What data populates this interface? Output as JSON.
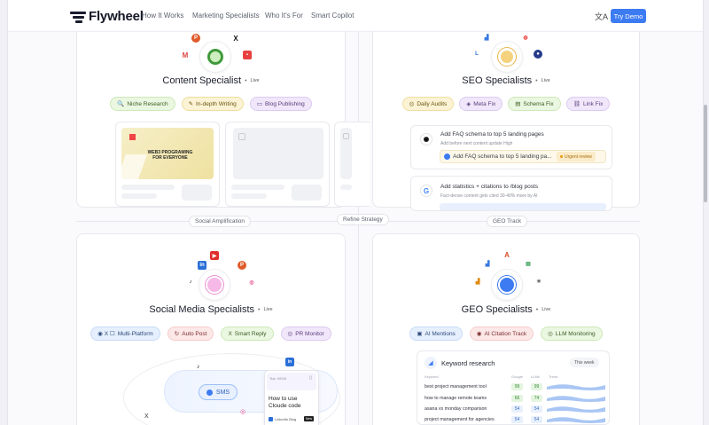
{
  "nav": {
    "brand": "Flywheel",
    "links": [
      "How It Works",
      "Marketing Specialists",
      "Who It's For",
      "Smart Copilot"
    ],
    "translate_icon": "文A",
    "cta": "Try Demo"
  },
  "connectors": {
    "social": "Social Amplification",
    "refine": "Refine Strategy",
    "geo": "GEO Track"
  },
  "content": {
    "title": "Content Specialist",
    "status": "Live",
    "chips": [
      {
        "icon": "🔍",
        "label": "Niche Research"
      },
      {
        "icon": "✎",
        "label": "In-depth Writing"
      },
      {
        "icon": "▭",
        "label": "Blog Publishing"
      }
    ],
    "preview_heading": "WEB3 PROGRAMING FOR EVERYONE"
  },
  "seo": {
    "title": "SEO Specialists",
    "status": "Live",
    "chips": [
      {
        "icon": "◎",
        "label": "Daily Audits"
      },
      {
        "icon": "◈",
        "label": "Meta Fix"
      },
      {
        "icon": "▤",
        "label": "Schema Fix"
      },
      {
        "icon": "⛓",
        "label": "Link Fix"
      }
    ],
    "task1": {
      "title": "Add FAQ schema to top 5 landing pages",
      "sub": "Add before next content update High",
      "subtask": "Add FAQ schema to top 5 landing pa...",
      "badge": "Urgent review"
    },
    "task2": {
      "title": "Add statistics + citations to /blog posts",
      "sub": "Fact-dense content gets cited 30-40% more by AI"
    }
  },
  "social": {
    "title": "Social Media Specialists",
    "status": "Live",
    "chips": [
      {
        "icon": "◉ X ☐",
        "label": "Multi-Platform"
      },
      {
        "icon": "↻",
        "label": "Auto Post"
      },
      {
        "icon": "X",
        "label": "Smart Reply"
      },
      {
        "icon": "◎",
        "label": "PR Monitor"
      }
    ],
    "sms_label": "SMS",
    "post": {
      "date": "Tue, 09:00",
      "text": "How to use Cloude code",
      "footer": "LinkedIn Blog",
      "tag": "New"
    }
  },
  "geo": {
    "title": "GEO Specialists",
    "status": "Live",
    "chips": [
      {
        "icon": "▣",
        "label": "AI Mentions"
      },
      {
        "icon": "◉",
        "label": "AI Citation Track"
      },
      {
        "icon": "◎",
        "label": "LLM Monitoring"
      }
    ],
    "keyword": {
      "title": "Keyword research",
      "period": "This week",
      "headers": [
        "Keyword",
        "Google",
        "LLMs",
        "Trend"
      ],
      "rows": [
        {
          "keyword": "best project management tool",
          "google": "99",
          "llm": "99"
        },
        {
          "keyword": "how to manage remote teams",
          "google": "66",
          "llm": "74"
        },
        {
          "keyword": "asana vs monday comparison",
          "google": "54",
          "llm": "54"
        },
        {
          "keyword": "project management for agencies",
          "google": "54",
          "llm": "54"
        }
      ]
    }
  },
  "colors": {
    "accent": "#3c7bf2",
    "green_chip": "#eaf7e1",
    "yellow_chip": "#fbf3d4",
    "purple_chip": "#f1e7fb",
    "blue_chip": "#e6effd",
    "red_chip": "#fde8e8"
  }
}
